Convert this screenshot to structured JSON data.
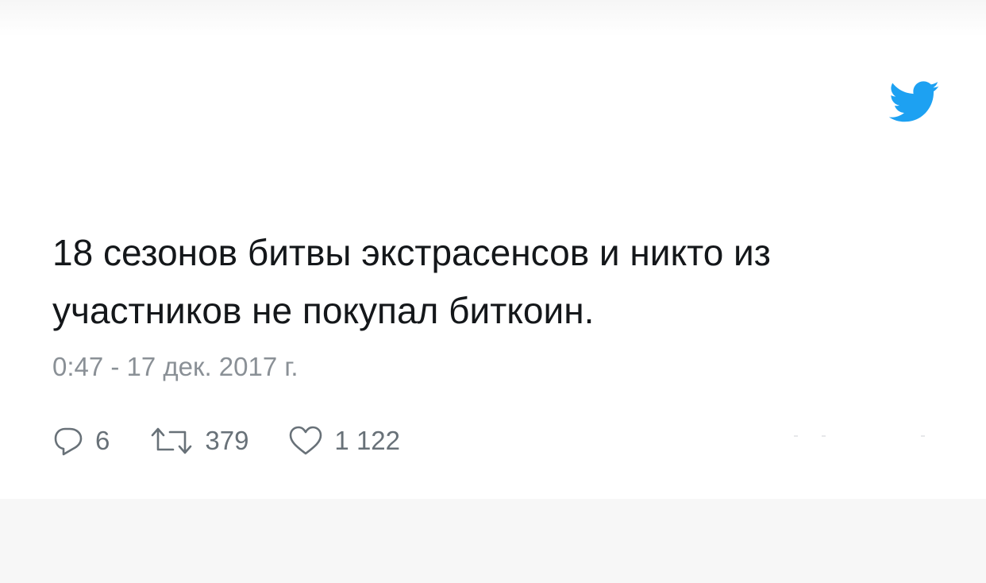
{
  "brand": {
    "icon": "twitter-bird-icon",
    "color": "#1da1f2"
  },
  "tweet": {
    "text_line1": "18 сезонов битвы экстрасенсов и никто из",
    "text_line2": "участников не покупал биткоин.",
    "timestamp": "0:47 - 17 дек. 2017 г."
  },
  "actions": {
    "replies": {
      "icon": "reply-icon",
      "count": "6"
    },
    "retweets": {
      "icon": "retweet-icon",
      "count": "379"
    },
    "likes": {
      "icon": "heart-icon",
      "count": "1 122"
    }
  },
  "colors": {
    "text": "#14171a",
    "meta": "#8a9096",
    "icon": "#687178",
    "background": "#ffffff"
  }
}
